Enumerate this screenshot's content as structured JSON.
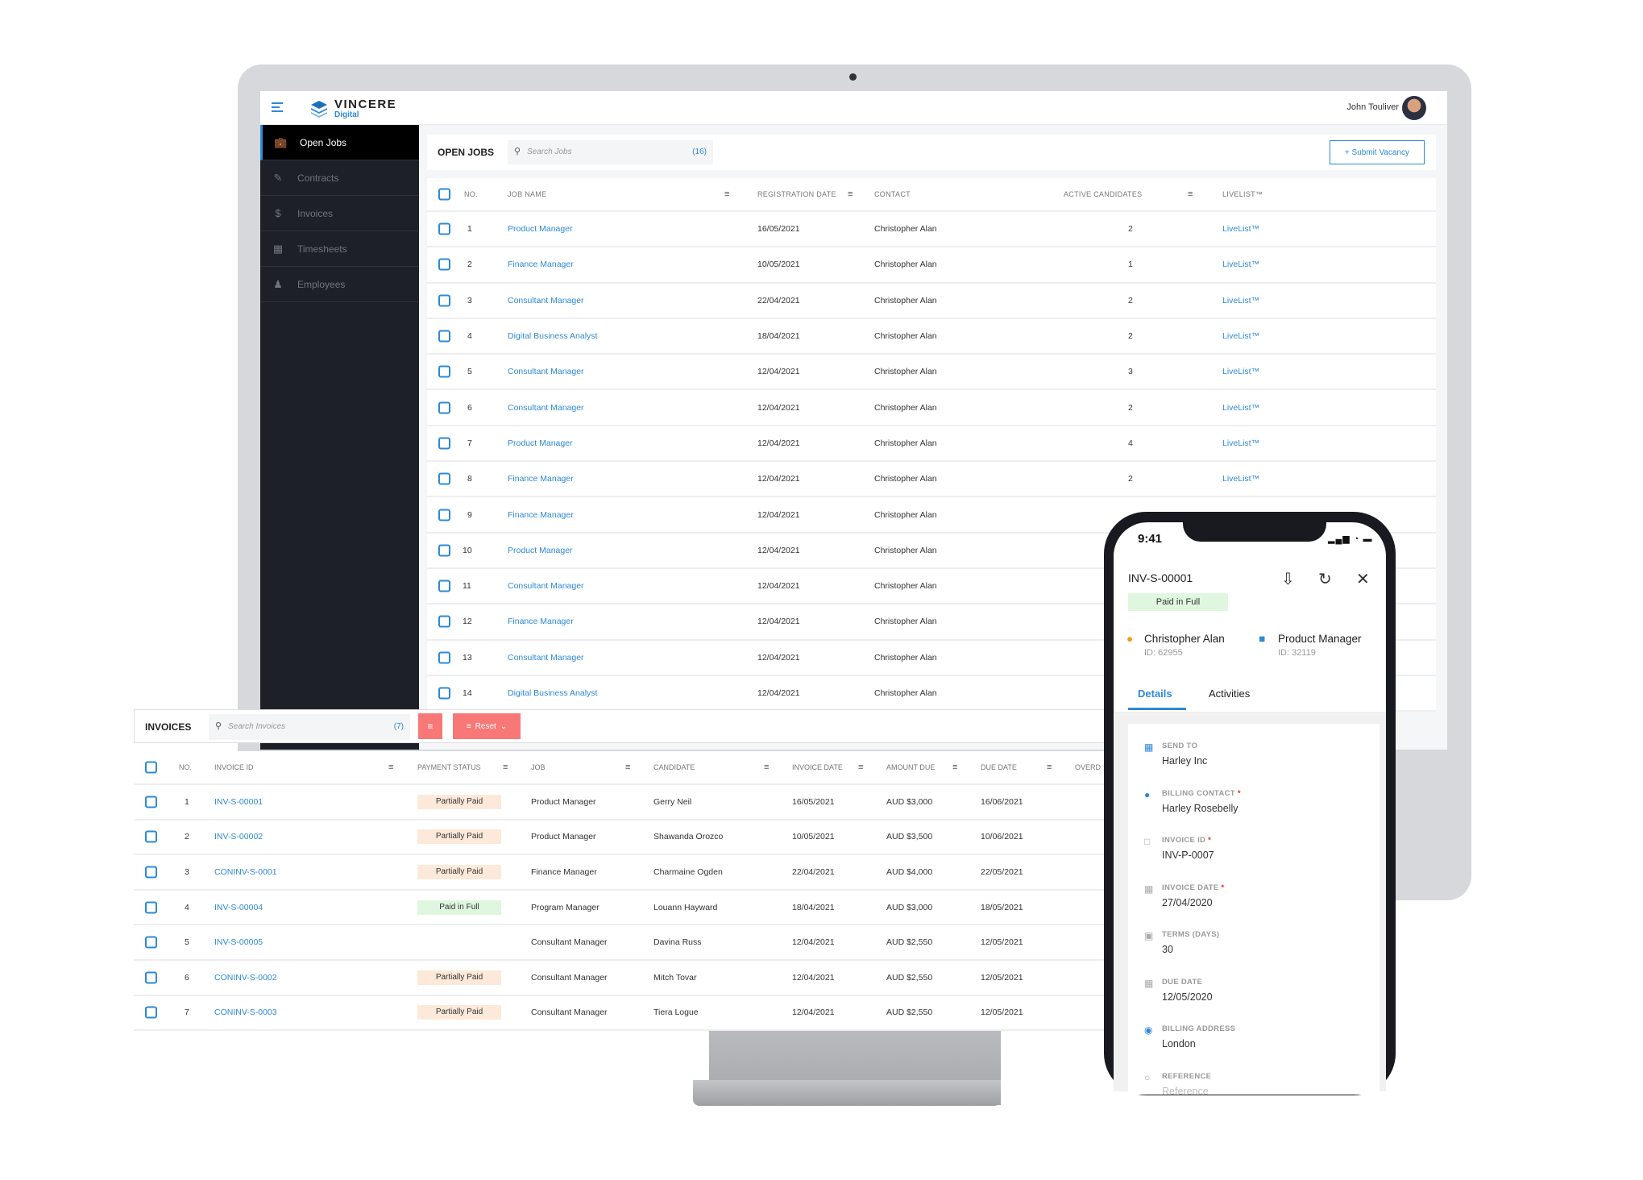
{
  "app": {
    "brand": "VINCERE",
    "brand_sub": "Digital",
    "user_name": "John Touliver"
  },
  "sidebar": {
    "items": [
      {
        "label": "Open Jobs",
        "icon": "briefcase-icon",
        "active": true
      },
      {
        "label": "Contracts",
        "icon": "contract-icon",
        "active": false
      },
      {
        "label": "Invoices",
        "icon": "dollar-icon",
        "active": false
      },
      {
        "label": "Timesheets",
        "icon": "calendar-icon",
        "active": false
      },
      {
        "label": "Employees",
        "icon": "user-icon",
        "active": false
      }
    ]
  },
  "open_jobs": {
    "title": "OPEN JOBS",
    "search_placeholder": "Search Jobs",
    "count": "(16)",
    "submit_label": "+ Submit Vacancy",
    "columns": [
      "NO.",
      "JOB NAME",
      "REGISTRATION DATE",
      "CONTACT",
      "ACTIVE CANDIDATES",
      "LIVELIST™"
    ],
    "rows": [
      {
        "no": "1",
        "job": "Product Manager",
        "date": "16/05/2021",
        "contact": "Christopher Alan",
        "active": "2",
        "livelist": "LiveList™"
      },
      {
        "no": "2",
        "job": "Finance Manager",
        "date": "10/05/2021",
        "contact": "Christopher Alan",
        "active": "1",
        "livelist": "LiveList™"
      },
      {
        "no": "3",
        "job": "Consultant Manager",
        "date": "22/04/2021",
        "contact": "Christopher Alan",
        "active": "2",
        "livelist": "LiveList™"
      },
      {
        "no": "4",
        "job": "Digital Business Analyst",
        "date": "18/04/2021",
        "contact": "Christopher Alan",
        "active": "2",
        "livelist": "LiveList™"
      },
      {
        "no": "5",
        "job": "Consultant Manager",
        "date": "12/04/2021",
        "contact": "Christopher Alan",
        "active": "3",
        "livelist": "LiveList™"
      },
      {
        "no": "6",
        "job": "Consultant Manager",
        "date": "12/04/2021",
        "contact": "Christopher Alan",
        "active": "2",
        "livelist": "LiveList™"
      },
      {
        "no": "7",
        "job": "Product Manager",
        "date": "12/04/2021",
        "contact": "Christopher Alan",
        "active": "4",
        "livelist": "LiveList™"
      },
      {
        "no": "8",
        "job": "Finance Manager",
        "date": "12/04/2021",
        "contact": "Christopher Alan",
        "active": "2",
        "livelist": "LiveList™"
      },
      {
        "no": "9",
        "job": "Finance Manager",
        "date": "12/04/2021",
        "contact": "Christopher Alan",
        "active": "",
        "livelist": ""
      },
      {
        "no": "10",
        "job": "Product Manager",
        "date": "12/04/2021",
        "contact": "Christopher Alan",
        "active": "",
        "livelist": ""
      },
      {
        "no": "11",
        "job": "Consultant Manager",
        "date": "12/04/2021",
        "contact": "Christopher Alan",
        "active": "",
        "livelist": ""
      },
      {
        "no": "12",
        "job": "Finance Manager",
        "date": "12/04/2021",
        "contact": "Christopher Alan",
        "active": "",
        "livelist": ""
      },
      {
        "no": "13",
        "job": "Consultant Manager",
        "date": "12/04/2021",
        "contact": "Christopher Alan",
        "active": "",
        "livelist": ""
      },
      {
        "no": "14",
        "job": "Digital Business Analyst",
        "date": "12/04/2021",
        "contact": "Christopher Alan",
        "active": "",
        "livelist": ""
      }
    ]
  },
  "invoices": {
    "title": "INVOICES",
    "search_placeholder": "Search Invoices",
    "count": "(7)",
    "reset_label": "Reset",
    "columns": [
      "NO.",
      "INVOICE ID",
      "PAYMENT STATUS",
      "JOB",
      "CANDIDATE",
      "INVOICE DATE",
      "AMOUNT DUE",
      "DUE DATE",
      "OVERD"
    ],
    "rows": [
      {
        "no": "1",
        "id": "INV-S-00001",
        "status": "Partially Paid",
        "status_type": "partial",
        "job": "Product Manager",
        "candidate": "Gerry Neil",
        "invoice_date": "16/05/2021",
        "amount": "AUD $3,000",
        "due": "16/06/2021"
      },
      {
        "no": "2",
        "id": "INV-S-00002",
        "status": "Partially Paid",
        "status_type": "partial",
        "job": "Product Manager",
        "candidate": "Shawanda Orozco",
        "invoice_date": "10/05/2021",
        "amount": "AUD $3,500",
        "due": "10/06/2021"
      },
      {
        "no": "3",
        "id": "CONINV-S-0001",
        "status": "Partially Paid",
        "status_type": "partial",
        "job": "Finance Manager",
        "candidate": "Charmaine Ogden",
        "invoice_date": "22/04/2021",
        "amount": "AUD $4,000",
        "due": "22/05/2021"
      },
      {
        "no": "4",
        "id": "INV-S-00004",
        "status": "Paid in Full",
        "status_type": "full",
        "job": "Program Manager",
        "candidate": "Louann Hayward",
        "invoice_date": "18/04/2021",
        "amount": "AUD $3,000",
        "due": "18/05/2021"
      },
      {
        "no": "5",
        "id": "INV-S-00005",
        "status": "",
        "status_type": "none",
        "job": "Consultant Manager",
        "candidate": "Davina Russ",
        "invoice_date": "12/04/2021",
        "amount": "AUD $2,550",
        "due": "12/05/2021"
      },
      {
        "no": "6",
        "id": "CONINV-S-0002",
        "status": "Partially Paid",
        "status_type": "partial",
        "job": "Consultant Manager",
        "candidate": "Mitch Tovar",
        "invoice_date": "12/04/2021",
        "amount": "AUD $2,550",
        "due": "12/05/2021"
      },
      {
        "no": "7",
        "id": "CONINV-S-0003",
        "status": "Partially Paid",
        "status_type": "partial",
        "job": "Consultant Manager",
        "candidate": "Tiera Logue",
        "invoice_date": "12/04/2021",
        "amount": "AUD $2,550",
        "due": "12/05/2021"
      }
    ]
  },
  "phone": {
    "time": "9:41",
    "status_icons": "▂▄▆ ◔ ▬",
    "invoice_id": "INV-S-00001",
    "badge": "Paid in Full",
    "candidate": {
      "name": "Christopher Alan",
      "id": "ID: 62955"
    },
    "job": {
      "name": "Product Manager",
      "id": "ID: 32119"
    },
    "tabs": [
      "Details",
      "Activities"
    ],
    "fields": [
      {
        "label": "SEND TO",
        "value": "Harley Inc",
        "required": false,
        "icon": "building-icon"
      },
      {
        "label": "BILLING CONTACT",
        "value": "Harley Rosebelly",
        "required": true,
        "icon": "person-icon"
      },
      {
        "label": "INVOICE ID",
        "value": "INV-P-0007",
        "required": true,
        "icon": "document-icon"
      },
      {
        "label": "INVOICE DATE",
        "value": "27/04/2020",
        "required": true,
        "icon": "calendar-icon"
      },
      {
        "label": "TERMS (DAYS)",
        "value": "30",
        "required": false,
        "icon": "calendar-day-icon"
      },
      {
        "label": "DUE DATE",
        "value": "12/05/2020",
        "required": false,
        "icon": "calendar-icon"
      },
      {
        "label": "BILLING ADDRESS",
        "value": "London",
        "required": false,
        "icon": "location-pin-icon"
      },
      {
        "label": "REFERENCE",
        "value": "Reference",
        "required": false,
        "icon": "user-outline-icon",
        "placeholder": true
      }
    ]
  },
  "colors": {
    "accent": "#2d8ad6",
    "sidebar_bg": "#1d2026",
    "partial_badge": "#fde9d9",
    "full_badge": "#def7de",
    "reset_button": "#f87878"
  }
}
